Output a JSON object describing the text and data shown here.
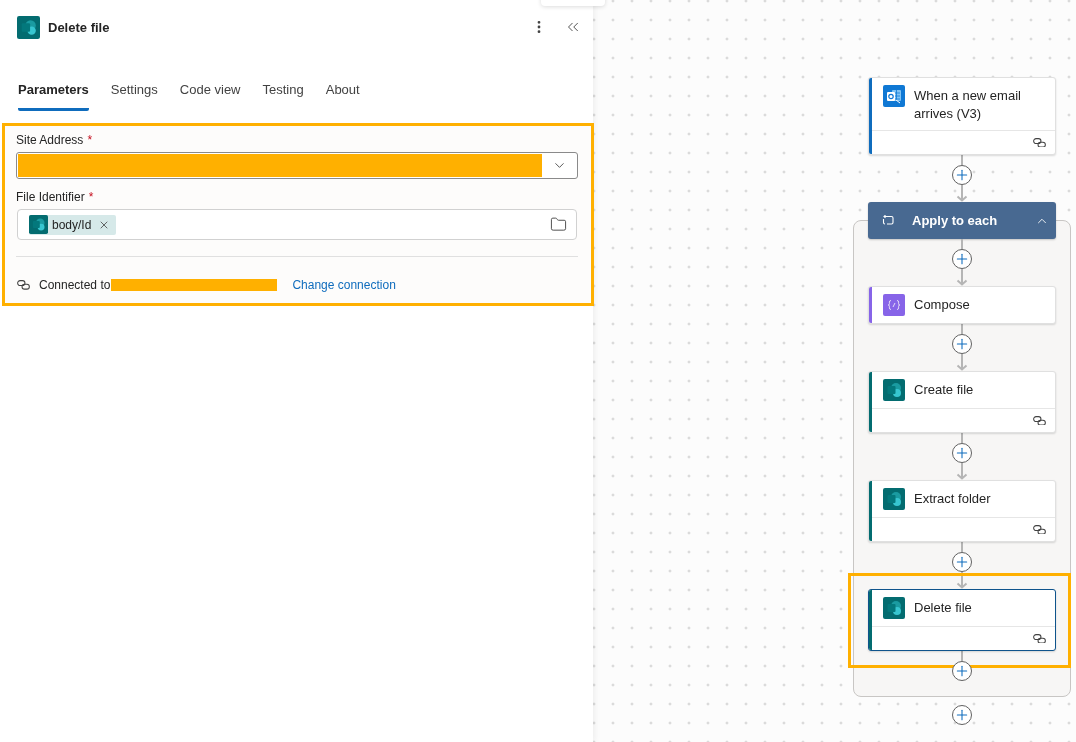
{
  "panel": {
    "title": "Delete file",
    "tabs": [
      {
        "label": "Parameters",
        "selected": true
      },
      {
        "label": "Settings",
        "selected": false
      },
      {
        "label": "Code view",
        "selected": false
      },
      {
        "label": "Testing",
        "selected": false
      },
      {
        "label": "About",
        "selected": false
      }
    ],
    "parameters": {
      "highlighted": true,
      "fields": [
        {
          "kind": "dropdown",
          "label": "Site Address",
          "required_mark": "*",
          "redacted": true
        },
        {
          "kind": "tokens",
          "label": "File Identifier",
          "required_mark": "*",
          "tokens": [
            {
              "label": "body/Id"
            }
          ]
        }
      ],
      "connection": {
        "label": "Connected to",
        "redacted": true,
        "link": "Change connection"
      }
    }
  },
  "flow": [
    {
      "kind": "email",
      "title": "When a new email arrives (V3)",
      "color": "#0f6cbd",
      "connection": true,
      "selected": false,
      "highlighted": false
    },
    {
      "kind": "loop",
      "title": "Apply to each",
      "expanded": true,
      "children": [
        {
          "kind": "compose",
          "title": "Compose",
          "color": "#8764e8",
          "connection": false,
          "selected": false,
          "highlighted": false
        },
        {
          "kind": "sharepoint",
          "title": "Create file",
          "color": "#036c70",
          "connection": true,
          "selected": false,
          "highlighted": false
        },
        {
          "kind": "sharepoint",
          "title": "Extract folder",
          "color": "#036c70",
          "connection": true,
          "selected": false,
          "highlighted": false
        },
        {
          "kind": "sharepoint",
          "title": "Delete file",
          "color": "#036c70",
          "connection": true,
          "selected": true,
          "highlighted": true
        }
      ]
    }
  ]
}
